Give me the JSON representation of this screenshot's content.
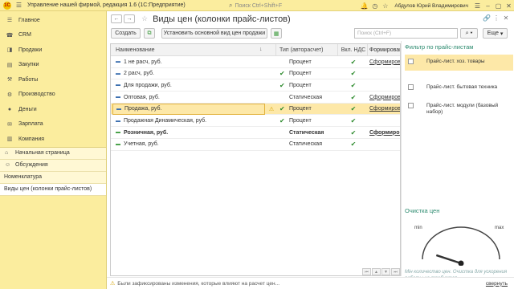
{
  "titlebar": {
    "title": "Управление нашей фирмой, редакция 1.6  (1С:Предприятие)",
    "search_placeholder": "Поиск Ctrl+Shift+F",
    "user": "Абдулов Юрий Владимирович"
  },
  "sidebar": {
    "sections": [
      {
        "icon": "menu-icon",
        "label": "Главное"
      },
      {
        "icon": "crm-icon",
        "label": "CRM"
      },
      {
        "icon": "sales-icon",
        "label": "Продажи"
      },
      {
        "icon": "purchases-icon",
        "label": "Закупки"
      },
      {
        "icon": "works-icon",
        "label": "Работы"
      },
      {
        "icon": "production-icon",
        "label": "Производство"
      },
      {
        "icon": "money-icon",
        "label": "Деньги"
      },
      {
        "icon": "salary-icon",
        "label": "Зарплата"
      },
      {
        "icon": "company-icon",
        "label": "Компания"
      }
    ],
    "open_windows": [
      {
        "label": "Начальная страница"
      },
      {
        "label": "Обсуждения"
      },
      {
        "label": "Номенклатура"
      },
      {
        "label": "Виды цен (колонки прайс-листов)"
      }
    ]
  },
  "form": {
    "title": "Виды цен (колонки прайс-листов)",
    "toolbar": {
      "create": "Создать",
      "set_main": "Установить основной вид цен продажи",
      "search_placeholder": "Поиск (Ctrl+F)",
      "more": "Еще"
    },
    "columns": [
      "Наименование",
      "Тип (авторасчет)",
      "Вкл. НДС",
      "Формирован"
    ],
    "rows": [
      {
        "name": "1 не расч, руб.",
        "autocalc": false,
        "type": "Процент",
        "vat": true,
        "form": "Сформирова",
        "bold": false,
        "selected": false,
        "warn": false
      },
      {
        "name": "2 расч, руб.",
        "autocalc": true,
        "type": "Процент",
        "vat": true,
        "form": "",
        "bold": false,
        "selected": false,
        "warn": false
      },
      {
        "name": "Для продажи, руб.",
        "autocalc": true,
        "type": "Процент",
        "vat": true,
        "form": "",
        "bold": false,
        "selected": false,
        "warn": false
      },
      {
        "name": "Оптовая, руб.",
        "autocalc": false,
        "type": "Статическая",
        "vat": true,
        "form": "Сформирова",
        "bold": false,
        "selected": false,
        "warn": false
      },
      {
        "name": "Продажа, руб.",
        "autocalc": true,
        "type": "Процент",
        "vat": true,
        "form": "Сформирова",
        "bold": false,
        "selected": true,
        "warn": true
      },
      {
        "name": "Продажная Динамическая, руб.",
        "autocalc": true,
        "type": "Процент",
        "vat": true,
        "form": "",
        "bold": false,
        "selected": false,
        "warn": false
      },
      {
        "name": "Розничная, руб.",
        "autocalc": false,
        "type": "Статическая",
        "vat": true,
        "form": "Сформирова",
        "bold": true,
        "selected": false,
        "warn": false
      },
      {
        "name": "Учетная, руб.",
        "autocalc": false,
        "type": "Статическая",
        "vat": true,
        "form": "",
        "bold": false,
        "selected": false,
        "warn": false
      }
    ]
  },
  "filter_panel": {
    "title": "Фильтр по прайс-листам",
    "items": [
      {
        "label": "Прайс-лист. хоз. товары",
        "checked": false,
        "active": true
      },
      {
        "label": "Прайс-лист. бытовая техника",
        "checked": false,
        "active": false
      },
      {
        "label": "Прайс-лист. модули (базовый набор)",
        "checked": false,
        "active": false
      }
    ],
    "gauge_title": "Очистка цен",
    "gauge_min": "min",
    "gauge_max": "max",
    "gauge_level": 0.2,
    "gauge_note": "Мін количество цен. Очистка для ускорения работы не требуется."
  },
  "status": {
    "message": "Были зафиксированы изменения, которые влияют на расчет цен...",
    "collapse": "свернуть"
  },
  "colors": {
    "accent_yellow": "#fbed9e",
    "selection": "#fde8a8",
    "green_check": "#2e8b2e",
    "filter_title": "#2b8a6e"
  }
}
